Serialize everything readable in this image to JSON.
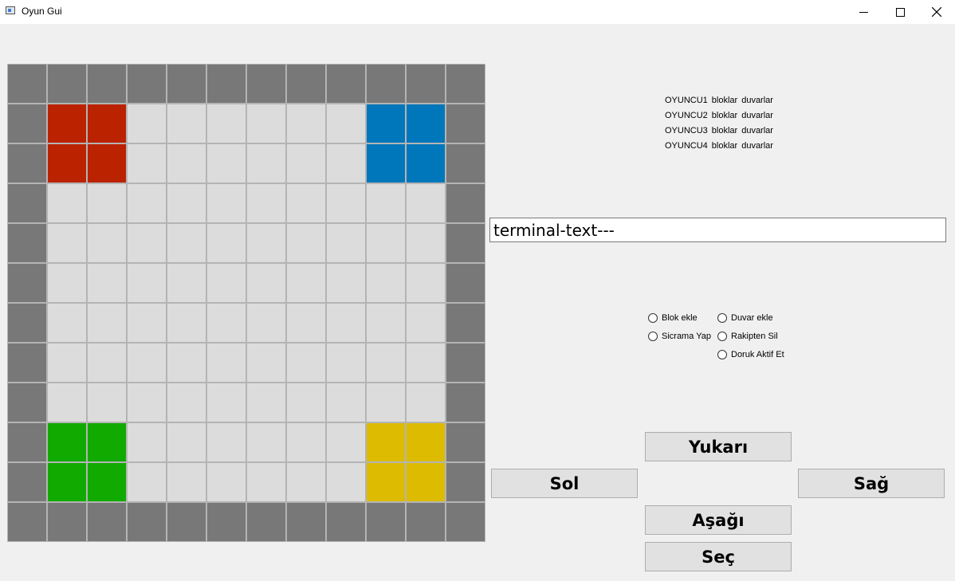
{
  "window": {
    "title": "Oyun Gui",
    "icon": "app-window-icon",
    "controls": [
      "minimize-icon",
      "maximize-icon",
      "close-icon"
    ]
  },
  "board": {
    "rows": 12,
    "cols": 12,
    "colors": {
      "wall": "#787878",
      "empty": "#dcdcdc",
      "red": "#bb2200",
      "blue": "#0077bb",
      "green": "#11aa00",
      "yellow": "#ddbb00"
    },
    "layout": [
      "WWWWWWWWWWWW",
      "WRR......BBW",
      "WRR......BBW",
      "W..........W",
      "W..........W",
      "W..........W",
      "W..........W",
      "W..........W",
      "W..........W",
      "WGG......YYW",
      "WGG......YYW",
      "WWWWWWWWWWWW"
    ]
  },
  "players": [
    {
      "name": "OYUNCU1",
      "blocks": "bloklar",
      "walls": "duvarlar"
    },
    {
      "name": "OYUNCU2",
      "blocks": "bloklar",
      "walls": "duvarlar"
    },
    {
      "name": "OYUNCU3",
      "blocks": "bloklar",
      "walls": "duvarlar"
    },
    {
      "name": "OYUNCU4",
      "blocks": "bloklar",
      "walls": "duvarlar"
    }
  ],
  "terminal": {
    "text": "terminal-text---"
  },
  "actions": {
    "blok_ekle": "Blok ekle",
    "duvar_ekle": "Duvar ekle",
    "sicrama_yap": "Sicrama Yap",
    "rakipten_sil": "Rakipten Sil",
    "doruk_aktif_et": "Doruk Aktif Et"
  },
  "controls": {
    "up": "Yukarı",
    "left": "Sol",
    "right": "Sağ",
    "down": "Aşağı",
    "select": "Seç"
  }
}
